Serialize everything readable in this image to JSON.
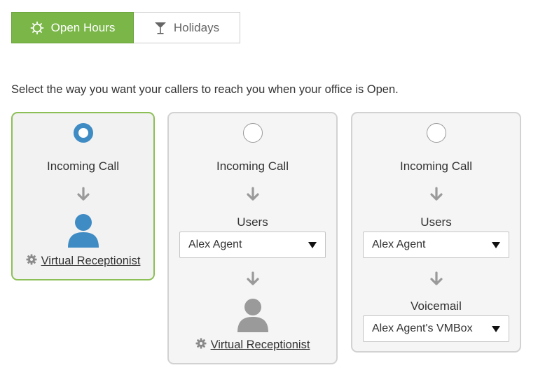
{
  "tabs": {
    "open_hours": "Open Hours",
    "holidays": "Holidays"
  },
  "instruction": "Select the way you want your callers to reach you when your office is Open.",
  "options": [
    {
      "selected": true,
      "incoming_call": "Incoming Call",
      "virtual_receptionist": "Virtual Receptionist"
    },
    {
      "selected": false,
      "incoming_call": "Incoming Call",
      "users_label": "Users",
      "users_value": "Alex Agent",
      "virtual_receptionist": "Virtual Receptionist"
    },
    {
      "selected": false,
      "incoming_call": "Incoming Call",
      "users_label": "Users",
      "users_value": "Alex Agent",
      "voicemail_label": "Voicemail",
      "voicemail_value": "Alex Agent's VMBox"
    }
  ],
  "colors": {
    "accent_green": "#7ab648",
    "selected_border": "#8cbf55",
    "radio_blue": "#3f8bc4",
    "avatar_blue": "#3f8bc4",
    "avatar_gray": "#9a9a9a"
  },
  "icons": {
    "open_hours": "sun-icon",
    "holidays": "cocktail-glass-icon",
    "flow": "arrow-down-icon",
    "receptionist": "user-icon",
    "settings": "gear-icon",
    "dropdown": "caret-down-icon"
  }
}
